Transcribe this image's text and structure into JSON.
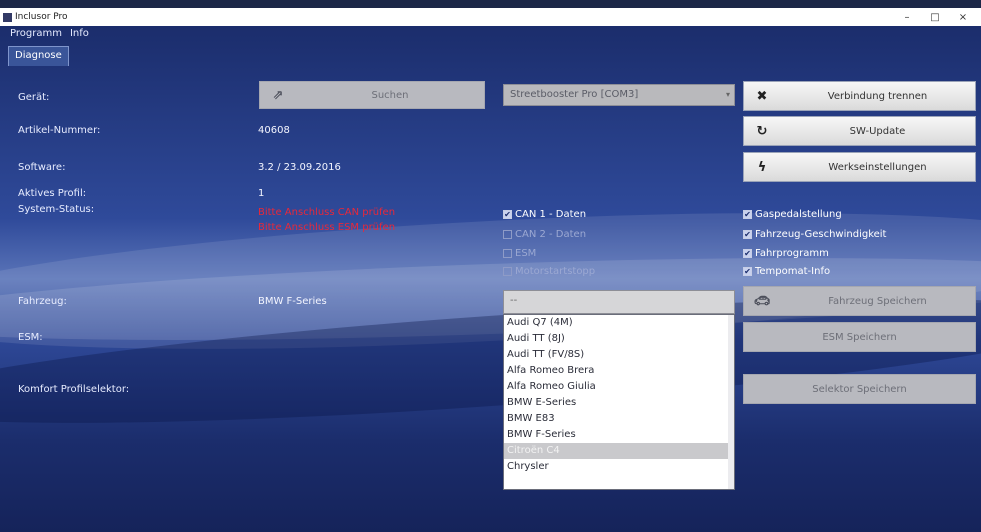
{
  "window": {
    "title": "Inclusor Pro",
    "controls": {
      "minimize": "–",
      "maximize": "□",
      "close": "×"
    }
  },
  "menu": [
    "Programm",
    "Info"
  ],
  "tabs": [
    "Diagnose"
  ],
  "fields": {
    "device_label": "Gerät:",
    "article_label": "Artikel-Nummer:",
    "article_value": "40608",
    "software_label": "Software:",
    "software_value": "3.2 / 23.09.2016",
    "active_profile_label": "Aktives Profil:",
    "active_profile_value": "1",
    "system_status_label": "System-Status:",
    "status_errors": [
      "Bitte Anschluss CAN prüfen",
      "Bitte Anschluss ESM prüfen"
    ],
    "vehicle_label": "Fahrzeug:",
    "vehicle_value": "BMW F-Series",
    "esm_label": "ESM:",
    "comfort_label": "Komfort Profilselektor:"
  },
  "buttons": {
    "search": "Suchen",
    "disconnect": "Verbindung trennen",
    "sw_update": "SW-Update",
    "factory_settings": "Werkseinstellungen",
    "save_vehicle": "Fahrzeug Speichern",
    "save_esm": "ESM Speichern",
    "save_selector": "Selektor Speichern"
  },
  "device_select": {
    "value": "Streetbooster Pro [COM3]"
  },
  "vehicle_select": {
    "value": "--"
  },
  "checks_left": [
    {
      "label": "CAN 1 - Daten",
      "checked": true
    },
    {
      "label": "CAN 2 - Daten",
      "checked": false
    },
    {
      "label": "ESM",
      "checked": false
    },
    {
      "label": "Motorstartstopp",
      "checked": false
    }
  ],
  "checks_right": [
    {
      "label": "Gaspedalstellung",
      "checked": true
    },
    {
      "label": "Fahrzeug-Geschwindigkeit",
      "checked": true
    },
    {
      "label": "Fahrprogramm",
      "checked": true
    },
    {
      "label": "Tempomat-Info",
      "checked": true
    }
  ],
  "vehicle_list": [
    "Audi Q7 (4M)",
    "Audi TT (8J)",
    "Audi TT (FV/8S)",
    "Alfa Romeo Brera",
    "Alfa Romeo Giulia",
    "BMW E-Series",
    "BMW E83",
    "BMW F-Series",
    "Citroën C4",
    "Chrysler"
  ],
  "vehicle_list_selected_index": 8,
  "colors": {
    "error": "#e8283a",
    "background": "#1b2d6c"
  },
  "icons": {
    "search": "external-link-icon",
    "disconnect": "x-icon",
    "sw_update": "refresh-icon",
    "factory_settings": "lightning-icon",
    "save_vehicle": "car-icon"
  }
}
